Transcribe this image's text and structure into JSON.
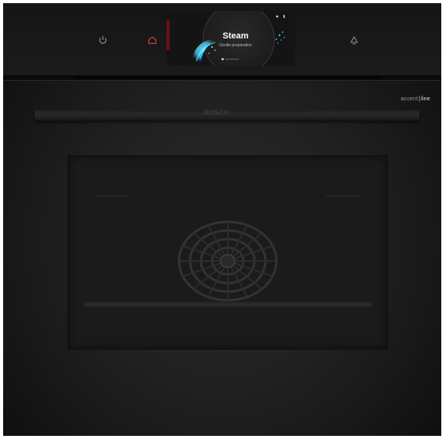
{
  "control_panel": {
    "icons": [
      {
        "name": "power-icon",
        "color": "#8d8d8d"
      },
      {
        "name": "home-icon",
        "color": "#d23b3b"
      },
      {
        "name": "light-icon",
        "color": "#8d8d8d"
      }
    ],
    "display": {
      "title": "Steam",
      "subtitle": "Gentle preparation",
      "accent_color": "#2fb8e0"
    }
  },
  "door": {
    "model_label_prefix": "accent",
    "model_label_suffix": "line",
    "brand": "BOSCH"
  }
}
